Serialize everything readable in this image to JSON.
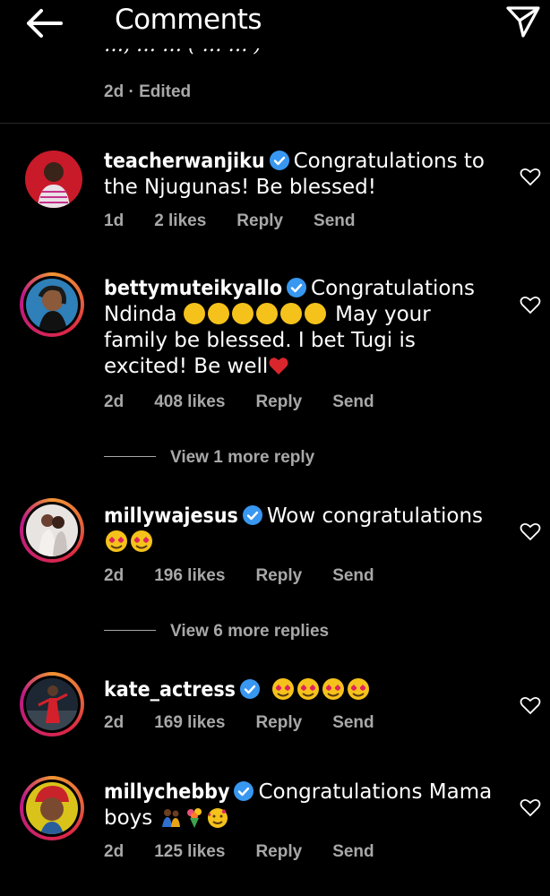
{
  "header": {
    "title": "Comments",
    "back_icon": "back-arrow-icon",
    "share_icon": "send-icon"
  },
  "top_comment": {
    "partial_text": "…, … … ( … … )",
    "age": "2d",
    "edited": "Edited"
  },
  "comments": [
    {
      "username": "teacherwanjiku",
      "text": "Congratulations to the Njugunas!  Be blessed!",
      "age": "1d",
      "likes": "2 likes",
      "reply": "Reply",
      "send": "Send"
    },
    {
      "username": "bettymuteikyallo",
      "text_a": "Congratulations Ndinda",
      "text_b": "May your family be blessed. I bet Tugi is excited! Be well",
      "age": "2d",
      "likes": "408 likes",
      "reply": "Reply",
      "send": "Send",
      "view_more": "View 1 more reply"
    },
    {
      "username": "millywajesus",
      "text": "Wow congratulations",
      "age": "2d",
      "likes": "196 likes",
      "reply": "Reply",
      "send": "Send",
      "view_more": "View 6 more replies"
    },
    {
      "username": "kate_actress",
      "age": "2d",
      "likes": "169 likes",
      "reply": "Reply",
      "send": "Send"
    },
    {
      "username": "millychebby",
      "text": "Congratulations Mama boys",
      "age": "2d",
      "likes": "125 likes",
      "reply": "Reply",
      "send": "Send"
    }
  ],
  "colors": {
    "background": "#000000",
    "text": "#ffffff",
    "meta": "#a8a8a8",
    "verified": "#3897f0",
    "story_ring": "#dc2743"
  }
}
